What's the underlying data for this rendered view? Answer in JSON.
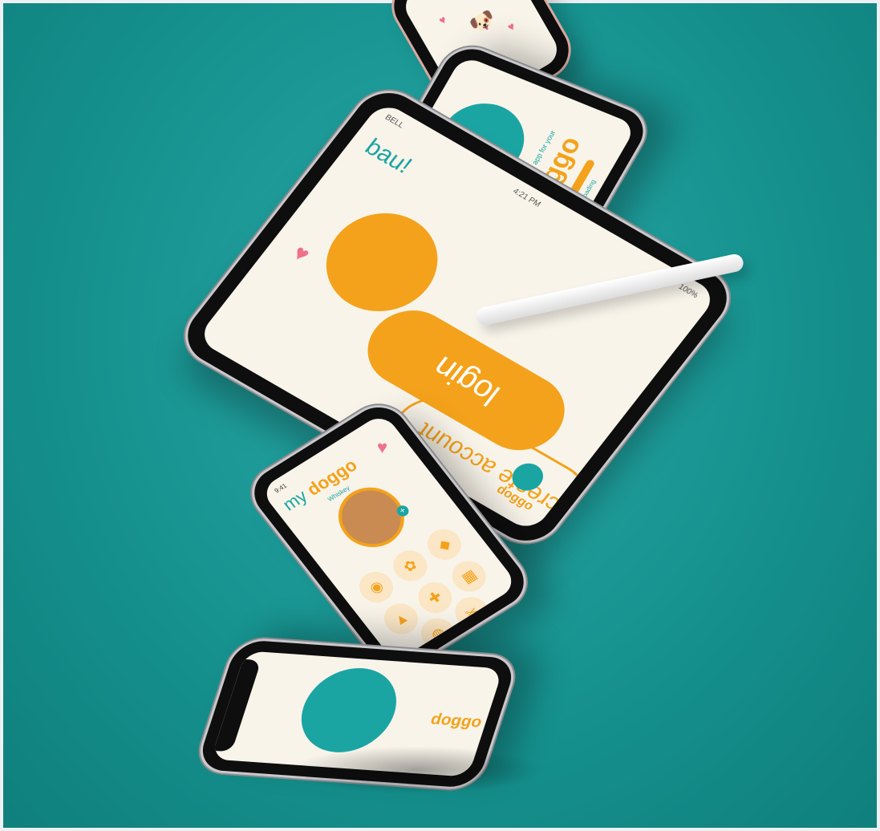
{
  "colors": {
    "teal": "#1aa5a3",
    "orange": "#f4a21b",
    "cream": "#f8f4ea",
    "pink": "#f07089"
  },
  "tablet": {
    "status_left": "BELL",
    "status_time": "4:21 PM",
    "status_right": "100%",
    "greeting": "bau!",
    "login_label": "login",
    "create_label": "create account",
    "brand": "doggo"
  },
  "phone_splash": {
    "tagline": "the all-in-one app for your",
    "brand": "doggo",
    "loading": "loading"
  },
  "phone_profile": {
    "time": "9:41",
    "title_prefix": "my",
    "title_brand": "doggo",
    "dog_name": "Whiskey",
    "grid_icons": [
      "food-icon",
      "paw-icon",
      "bone-icon",
      "corgi-icon",
      "vet-icon",
      "walk-icon",
      "bath-icon",
      "health-icon",
      "calendar-icon",
      "grooming-icon"
    ]
  },
  "phone_bottom": {
    "brand": "doggo"
  }
}
